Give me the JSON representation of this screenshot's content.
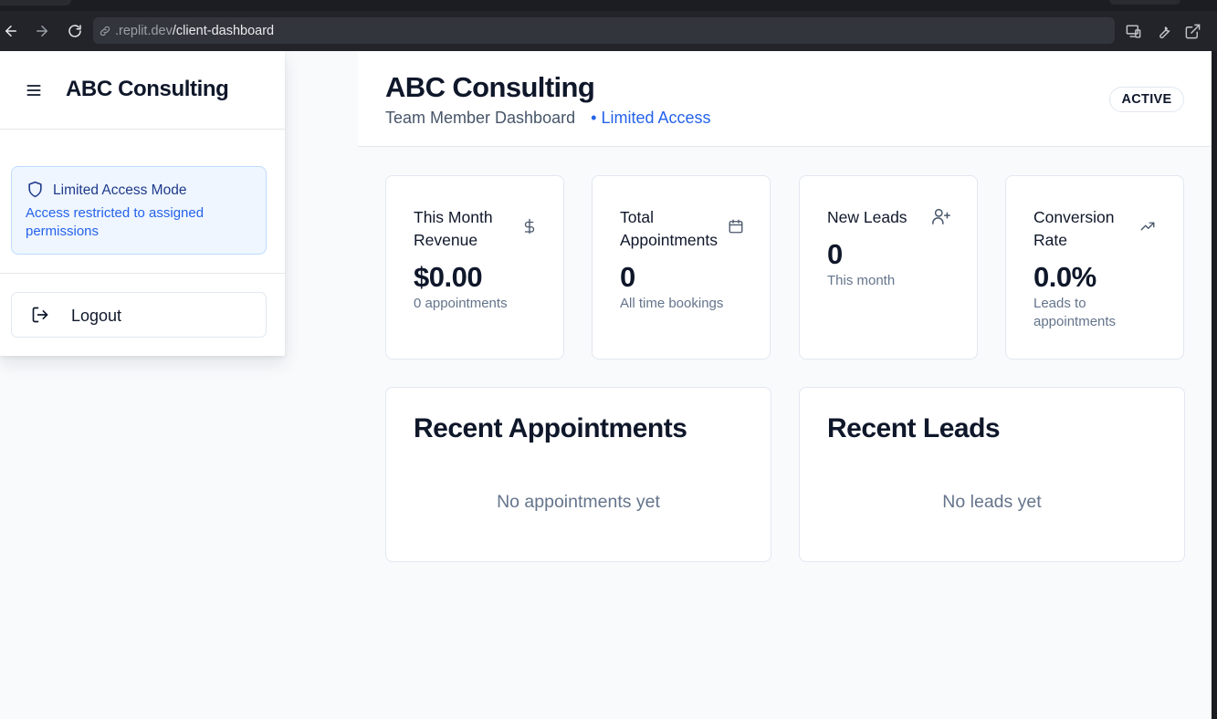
{
  "browser": {
    "url_prefix": ".replit.dev",
    "url_path": "/client-dashboard"
  },
  "sidebar": {
    "title": "ABC Consulting",
    "access_notice": {
      "title": "Limited Access Mode",
      "description": "Access restricted to assigned permissions"
    },
    "logout_label": "Logout"
  },
  "header": {
    "title": "ABC Consulting",
    "subtitle": "Team Member Dashboard",
    "access_separator": "•",
    "access_label": "Limited Access",
    "status_badge": "ACTIVE"
  },
  "stats": [
    {
      "title": "This Month Revenue",
      "icon": "dollar-icon",
      "value": "$0.00",
      "sub": "0 appointments"
    },
    {
      "title": "Total Appointments",
      "icon": "calendar-icon",
      "value": "0",
      "sub": "All time bookings"
    },
    {
      "title": "New Leads",
      "icon": "user-plus-icon",
      "value": "0",
      "sub": "This month"
    },
    {
      "title": "Conversion Rate",
      "icon": "trending-up-icon",
      "value": "0.0%",
      "sub": "Leads to appointments"
    }
  ],
  "recent_appointments": {
    "title": "Recent Appointments",
    "empty": "No appointments yet"
  },
  "recent_leads": {
    "title": "Recent Leads",
    "empty": "No leads yet"
  },
  "colors": {
    "accent": "#2563eb",
    "access_bg": "#eff6ff",
    "text": "#0f172a",
    "muted": "#64748b"
  }
}
